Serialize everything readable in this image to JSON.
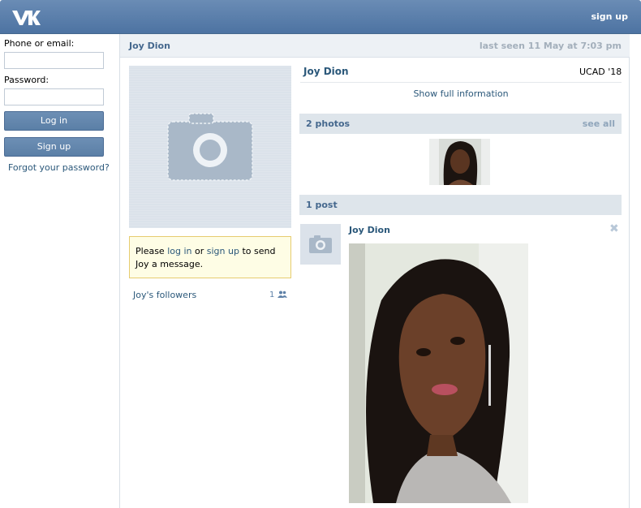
{
  "topbar": {
    "signup_label": "sign up"
  },
  "login": {
    "phone_label": "Phone or email:",
    "password_label": "Password:",
    "login_button": "Log in",
    "signup_button": "Sign up",
    "forgot_link": "Forgot your password?"
  },
  "profile": {
    "header_name": "Joy Dion",
    "last_seen": "last seen 11 May at 7:03 pm",
    "name": "Joy Dion",
    "school": "UCAD '18",
    "show_full_info": "Show full information",
    "notice": {
      "pre": "Please ",
      "login": "log in",
      "or": " or ",
      "signup": "sign up",
      "post": " to send Joy a message."
    },
    "followers_label": "Joy's followers",
    "followers_count": "1"
  },
  "photos": {
    "title": "2 photos",
    "see_all": "see all"
  },
  "posts": {
    "title": "1 post",
    "author": "Joy Dion",
    "close": "✖"
  },
  "colors": {
    "header": "#5b7fa6",
    "link": "#2b587a",
    "bar": "#dee5eb"
  }
}
